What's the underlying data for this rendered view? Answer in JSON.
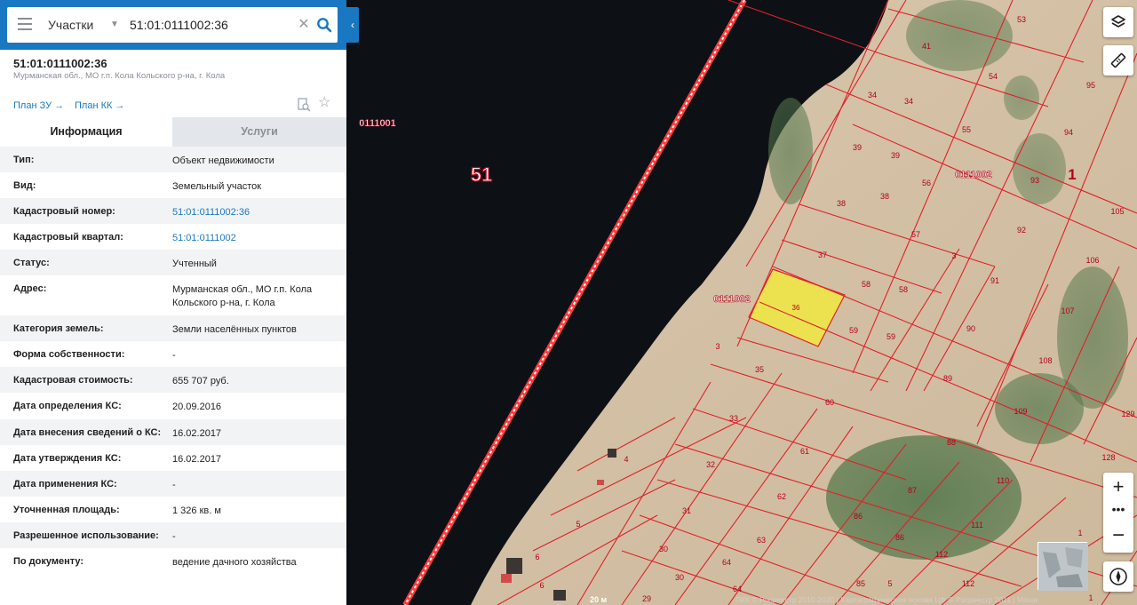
{
  "search": {
    "layer": "Участки",
    "query": "51:01:0111002:36",
    "clear_symbol": "✕",
    "collapse_symbol": "‹"
  },
  "object": {
    "title": "51:01:0111002:36",
    "subtitle": "Мурманская обл., МО г.п. Кола Кольского р-на, г. Кола",
    "plan_zu": "План ЗУ",
    "plan_kk": "План КК",
    "arrow": "→"
  },
  "tabs": {
    "info": "Информация",
    "services": "Услуги"
  },
  "rows": [
    {
      "k": "Тип:",
      "v": "Объект недвижимости"
    },
    {
      "k": "Вид:",
      "v": "Земельный участок"
    },
    {
      "k": "Кадастровый номер:",
      "v": "51:01:0111002:36"
    },
    {
      "k": "Кадастровый квартал:",
      "v": "51:01:0111002"
    },
    {
      "k": "Статус:",
      "v": "Учтенный"
    },
    {
      "k": "Адрес:",
      "v": "Мурманская обл., МО г.п. Кола Кольского р-на, г. Кола"
    },
    {
      "k": "Категория земель:",
      "v": "Земли населённых пунктов"
    },
    {
      "k": "Форма собственности:",
      "v": "-"
    },
    {
      "k": "Кадастровая стоимость:",
      "v": "655 707 руб."
    },
    {
      "k": "Дата определения КС:",
      "v": "20.09.2016"
    },
    {
      "k": "Дата внесения сведений о КС:",
      "v": "16.02.2017"
    },
    {
      "k": "Дата утверждения КС:",
      "v": "16.02.2017"
    },
    {
      "k": "Дата применения КС:",
      "v": "-"
    },
    {
      "k": "Уточненная площадь:",
      "v": "1 326 кв. м"
    },
    {
      "k": "Разрешенное использование:",
      "v": "-"
    },
    {
      "k": "По документу:",
      "v": "ведение дачного хозяйства"
    }
  ],
  "map": {
    "region_label": "51",
    "quarter_label_water": "0111001",
    "quarter_label_1": "0111002",
    "quarter_label_2": "0111002",
    "selected_parcel": "36",
    "big_label_1": "1",
    "parcel_labels": [
      "53",
      "41",
      "54",
      "95",
      "34",
      "34",
      "55",
      "94",
      "39",
      "39",
      "56",
      "93",
      "38",
      "38",
      "57",
      "92",
      "105",
      "37",
      "3",
      "91",
      "106",
      "58",
      "58",
      "107",
      "59",
      "59",
      "90",
      "108",
      "3",
      "35",
      "89",
      "109",
      "60",
      "129",
      "33",
      "88",
      "128",
      "61",
      "32",
      "4",
      "62",
      "110",
      "87",
      "31",
      "5",
      "63",
      "86",
      "111",
      "86",
      "1",
      "30",
      "64",
      "112",
      "6",
      "30",
      "85",
      "112",
      "29",
      "64",
      "5",
      "6",
      "1"
    ],
    "scale": "20 м",
    "attribution": "ПКК © Росреестр 2010-2020 | Картографическая основа ЦФ © Росреестр 2011 | Maxar"
  },
  "controls": {
    "zoom_in": "+",
    "zoom_more": "•••",
    "zoom_out": "−"
  },
  "colors": {
    "accent": "#1a78c2",
    "parcel_line": "#e0202a",
    "selected_fill": "#f2ea3a"
  }
}
